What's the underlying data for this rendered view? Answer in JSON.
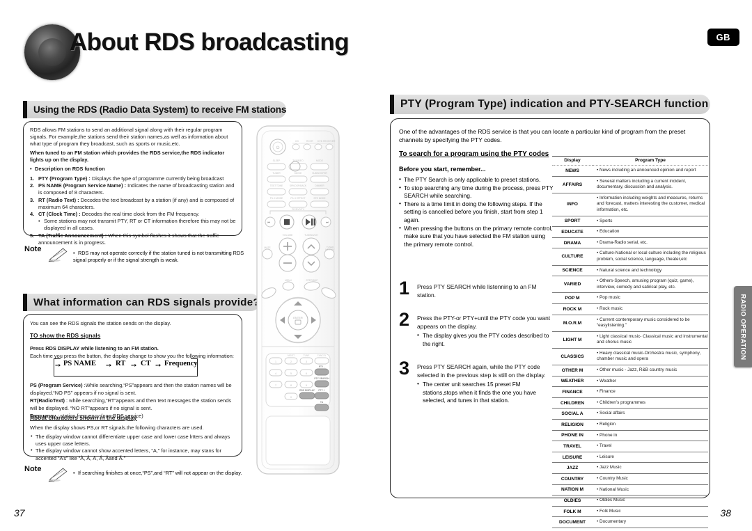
{
  "header": {
    "title": "About RDS broadcasting",
    "region_badge": "GB",
    "logo_icon": "speaker-cone-icon"
  },
  "side_tab": {
    "label": "RADIO OPERATION"
  },
  "page_numbers": {
    "left": "37",
    "right": "38"
  },
  "left_column": {
    "section1": {
      "heading": "Using the RDS (Radio Data System) to receive FM stations",
      "intro": "RDS allows FM stations to send an additional signal along with their regular program signals. For example,the stations send their station names,as well as information about what  type of program they broadcast, such as sports or music,etc.",
      "bold_note": "When tuned to an FM station which provides the RDS service,the RDS indicator lights up on the display.",
      "subhead": "Description on RDS function",
      "items": [
        {
          "n": "1.",
          "term": "PTY (Program Type) :",
          "desc": " Displays the type of programme currently being broadcast"
        },
        {
          "n": "2.",
          "term": "PS NAME (Program Service Name) :",
          "desc": " Indicates the name of broadcasting station and is composed of 8 characters."
        },
        {
          "n": "3.",
          "term": "RT (Radio Text) :",
          "desc": " Decodes the text broadcast by a station (if any) and is composed of maximum 64 characters."
        },
        {
          "n": "4.",
          "term": "CT (Clock Time) :",
          "desc": " Decodes the real time clock from the FM frequency."
        }
      ],
      "sub_bullet": "Some stations may not transmit PTY, RT or CT information therefore this may not be displayed in all cases.",
      "item5": {
        "n": "5.",
        "term": "TA (Traffic Announcement) :",
        "desc": " When this symbol flashes it shows that the traffic announcement is in progress."
      }
    },
    "note1": {
      "label": "Note",
      "icon": "pencil-icon",
      "text": "RDS may not operate correctly if the station tuned is not transmitting RDS signal properly or if the signal strength is weak."
    },
    "section2": {
      "heading": "What information can RDS signals provide?",
      "intro": "You can see the RDS signals the station sends on the display.",
      "subhead1": "TO show the RDS signals",
      "bold_line": "Press RDS DISPLAY while listening to an FM station.",
      "line2": "Each time you press the button, the display change to show you the following information:",
      "flow": [
        "PS NAME",
        "RT",
        "CT",
        "Frequency"
      ],
      "defs": [
        {
          "term": "PS (Program Service)",
          "desc": " :While searching,“PS”appears and then the station names will be displayed.“NO PS” appears if no signal is sent."
        },
        {
          "term": "RT(RadioText)",
          "desc": " : while searching,“RT”appears and then text messages the station sends will be displayed. “NO RT”appears if no signal is sent."
        },
        {
          "term": "Frequency",
          "desc": " : station frequency (non-RDS service)"
        }
      ],
      "subhead2": "About characters shown in the display",
      "intro2": "When the display shows PS,or RT signals.the following characters are used.",
      "bullets": [
        "The display window cannot differentiate upper case and lower case lrtters and always uses upper case letters.",
        "The display window  cannot show accented letters, “A,” for instance, may stans for accented “A’s” like “À, Â, Ä, Á, Åand Ã.”"
      ]
    },
    "note2": {
      "label": "Note",
      "icon": "pencil-icon",
      "text": "If searching finishes at once,“PS”,and “RT” will not appear on the display."
    }
  },
  "remote": {
    "name": "primary-remote-control-illustration",
    "top_labels": [
      "CD",
      "RCVR",
      "DVD RECEIVER"
    ],
    "rows": [
      [
        "SLEEP",
        "TV/VIDEO",
        "MODE"
      ],
      [
        "TUNER",
        "MOVIE",
        "SUBWOOFER"
      ],
      [
        "TEST TONE",
        "SPK/DSP/BACK",
        "DIMMER"
      ],
      [
        "P/L II MODE",
        "P/L II EFFECT",
        "SFE MODE"
      ]
    ],
    "transport_label": "CD/DVD/TV",
    "volume_label": "VOLUME",
    "tuning_label": "TUNING/CH",
    "mute_label": "MUTE",
    "tuner_memory_label": "TUNER MEMORY",
    "menu_label": "MENU",
    "step_skip_label": "STEP/SKIP",
    "enter_label": "ENTER",
    "keypad": [
      "1",
      "2",
      "3",
      "4",
      "5",
      "6",
      "7",
      "8",
      "9",
      "0"
    ],
    "highlight_buttons": [
      "PTY -",
      "PTY SEARCH",
      "RDS DISPLAY",
      "PTY +",
      "TA"
    ]
  },
  "right_column": {
    "heading": "PTY (Program Type) indication and PTY-SEARCH function",
    "intro": "One  of the advantages of the RDS service is that you can locate a particular kind of program from the preset channels by specifying the PTY codes.",
    "subhead": "To search for a program using the PTY codes",
    "before_title": "Before you start, remember...",
    "before_bullets": [
      "The PTY Search is only applicable to preset stations.",
      "To stop searching any time during the process, press PTY SEARCH while searching.",
      "There is a time limit in doing the following steps. If the setting is cancelled before you finish, start from step 1 again.",
      "When pressing the buttons on the primary remote control, make sure that you have selected the FM station using the primary remote control."
    ],
    "steps": [
      {
        "n": "1",
        "text": "Press PTY SEARCH while listenning to an FM station.",
        "bullets": []
      },
      {
        "n": "2",
        "text": "Press the PTY-or PTY+until the PTY code you want appears on the display.",
        "bullets": [
          "The display gives you the PTY codes described to the right."
        ]
      },
      {
        "n": "3",
        "text": "Press PTY SEARCH again, while the PTY code selected in the previous step is still on the display.",
        "bullets": [
          "The center unit searches 15 preset FM stations,stops when it finds the one you have selected, and tunes in that station."
        ]
      }
    ],
    "table": {
      "headers": [
        "Display",
        "Program Type"
      ],
      "rows": [
        {
          "code": "NEWS",
          "desc": "News including an announced opinion and report"
        },
        {
          "code": "AFFAIRS",
          "desc": "Several matters including a current incident, documentary, discussion and analysis."
        },
        {
          "code": "INFO",
          "desc": "Information including weights and measures, returns and forecast, matters interesting the customer, medical information, etc."
        },
        {
          "code": "SPORT",
          "desc": "Sports"
        },
        {
          "code": "EDUCATE",
          "desc": "Education"
        },
        {
          "code": "DRAMA",
          "desc": "Drama-Radio serial, etc."
        },
        {
          "code": "CULTURE",
          "desc": "Culture-National or local culture including the religious problem, social science, language, theater,etc"
        },
        {
          "code": "SCIENCE",
          "desc": "Natural science and technology"
        },
        {
          "code": "VARIED",
          "desc": "Others-Speech, amusing program (quiz, game), interview, comedy and satirical play, etc."
        },
        {
          "code": "POP M",
          "desc": "Pop music"
        },
        {
          "code": "ROCK M",
          "desc": "Rock music"
        },
        {
          "code": "M.O.R.M",
          "desc": "Current contemporary music considered to be “easylistening.”"
        },
        {
          "code": "LIGHT M",
          "desc": "Light classical music- Classical music and instrumental and chorus music"
        },
        {
          "code": "CLASSICS",
          "desc": "Heavy classical  music-Orchestra music, symphony, chamber music and opera"
        },
        {
          "code": "OTHER M",
          "desc": "Other music - Jazz, R&B country music"
        },
        {
          "code": "WEATHER",
          "desc": "Weather"
        },
        {
          "code": "FINANCE",
          "desc": "Finance"
        },
        {
          "code": "CHILDREN",
          "desc": "Children’s programmes"
        },
        {
          "code": "SOCIAL  A",
          "desc": "Social affairs"
        },
        {
          "code": "RELIGION",
          "desc": "Religion"
        },
        {
          "code": "PHONE IN",
          "desc": "Phone in"
        },
        {
          "code": "TRAVEL",
          "desc": "Travel"
        },
        {
          "code": "LEISURE",
          "desc": "Leisure"
        },
        {
          "code": "JAZZ",
          "desc": "Jazz Music"
        },
        {
          "code": "COUNTRY",
          "desc": "Country Music"
        },
        {
          "code": "NATION M",
          "desc": "National Music"
        },
        {
          "code": "OLDIES",
          "desc": "Oldies Music"
        },
        {
          "code": "FOLK M",
          "desc": "Folk Music"
        },
        {
          "code": "DOCUMENT",
          "desc": "Documentary"
        }
      ]
    }
  }
}
